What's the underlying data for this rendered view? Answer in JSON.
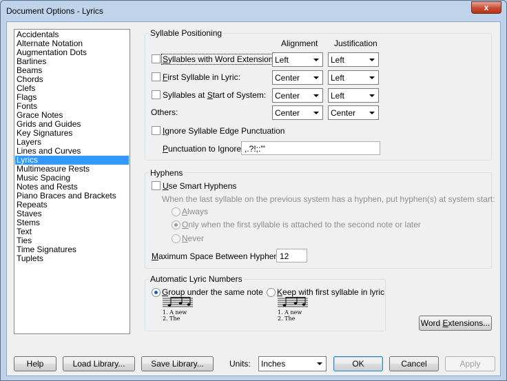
{
  "window": {
    "title": "Document Options - Lyrics",
    "close_label": "x"
  },
  "sidebar": {
    "items": [
      "Accidentals",
      "Alternate Notation",
      "Augmentation Dots",
      "Barlines",
      "Beams",
      "Chords",
      "Clefs",
      "Flags",
      "Fonts",
      "Grace Notes",
      "Grids and Guides",
      "Key Signatures",
      "Layers",
      "Lines and Curves",
      "Lyrics",
      "Multimeasure Rests",
      "Music Spacing",
      "Notes and Rests",
      "Piano Braces and Brackets",
      "Repeats",
      "Staves",
      "Stems",
      "Text",
      "Ties",
      "Time Signatures",
      "Tuplets"
    ],
    "selected_index": 14
  },
  "syllable_positioning": {
    "title": "Syllable Positioning",
    "alignment_header": "Alignment",
    "justification_header": "Justification",
    "rows": [
      {
        "label_pre": "",
        "label_u": "S",
        "label_post": "yllables with Word Extensions:",
        "checked": false,
        "alignment": "Left",
        "justification": "Left"
      },
      {
        "label_pre": "",
        "label_u": "F",
        "label_post": "irst Syllable in Lyric:",
        "checked": false,
        "alignment": "Center",
        "justification": "Left"
      },
      {
        "label_pre": "Syllables at ",
        "label_u": "S",
        "label_post": "tart of System:",
        "checked": false,
        "alignment": "Center",
        "justification": "Left"
      }
    ],
    "others_label": "Others:",
    "others_alignment": "Center",
    "others_justification": "Center",
    "ignore_edge_pre": "",
    "ignore_edge_u": "I",
    "ignore_edge_post": "gnore Syllable Edge Punctuation",
    "ignore_edge_checked": false,
    "punct_label_u": "P",
    "punct_label_post": "unctuation to Ignore:",
    "punct_value": ",.?!;:'\""
  },
  "hyphens": {
    "title": "Hyphens",
    "smart_u": "U",
    "smart_post": "se Smart Hyphens",
    "smart_checked": false,
    "description": "When the last syllable on the previous system has a hyphen, put hyphen(s) at system start:",
    "options": [
      {
        "u": "A",
        "post": "lways",
        "checked": false
      },
      {
        "u": "O",
        "post": "nly when the first syllable is attached to the second note or later",
        "checked": true
      },
      {
        "u": "N",
        "post": "ever",
        "checked": false
      }
    ],
    "max_space_u": "M",
    "max_space_post": "aximum Space Between Hyphens:",
    "max_space_value": "12"
  },
  "lyric_numbers": {
    "title": "Automatic Lyric Numbers",
    "group_u": "G",
    "group_post": "roup under the same note",
    "group_checked": true,
    "keep_u": "K",
    "keep_post": "eep with first syllable in lyric",
    "keep_checked": false,
    "example_group": {
      "line1": "1. A    new",
      "line2": "2.        The"
    },
    "example_keep": {
      "line1": "1. A    new",
      "line2": "    2. The"
    }
  },
  "word_extensions_button": {
    "pre": "Word ",
    "u": "E",
    "post": "xtensions..."
  },
  "footer": {
    "help": "Help",
    "load_library": "Load Library...",
    "save_library": "Save Library...",
    "units_label": "Units:",
    "units_value": "Inches",
    "ok": "OK",
    "cancel": "Cancel",
    "apply": "Apply"
  }
}
